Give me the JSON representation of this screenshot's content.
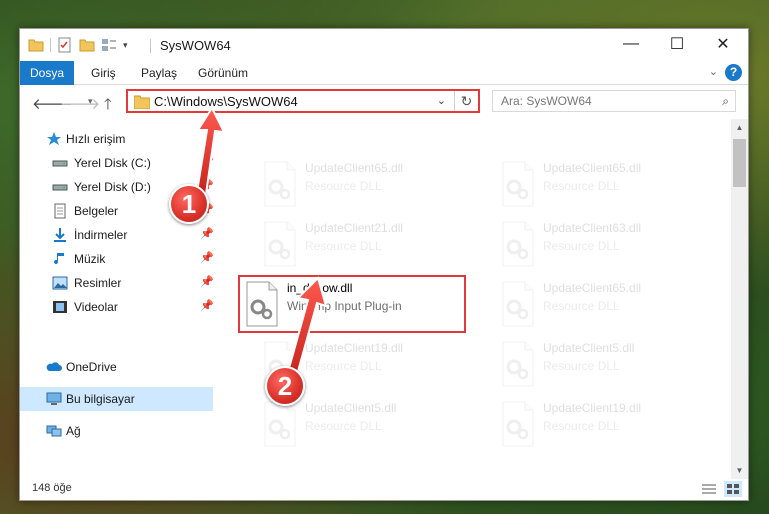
{
  "window": {
    "title": "SysWOW64",
    "controls": {
      "minimize": "—",
      "maximize": "☐",
      "close": "✕"
    }
  },
  "ribbon": {
    "tabs": [
      "Dosya",
      "Giriş",
      "Paylaş",
      "Görünüm"
    ],
    "help": "?"
  },
  "navigation": {
    "address": "C:\\Windows\\SysWOW64",
    "search_placeholder": "Ara: SysWOW64"
  },
  "sidebar": {
    "quick_access": "Hızlı erişim",
    "items": [
      {
        "label": "Yerel Disk (C:)",
        "icon": "drive-icon",
        "pinned": true
      },
      {
        "label": "Yerel Disk (D:)",
        "icon": "drive-icon",
        "pinned": true
      },
      {
        "label": "Belgeler",
        "icon": "documents-icon",
        "pinned": true
      },
      {
        "label": "İndirmeler",
        "icon": "downloads-icon",
        "pinned": true
      },
      {
        "label": "Müzik",
        "icon": "music-icon",
        "pinned": true
      },
      {
        "label": "Resimler",
        "icon": "pictures-icon",
        "pinned": true
      },
      {
        "label": "Videolar",
        "icon": "videos-icon",
        "pinned": true
      }
    ],
    "onedrive": "OneDrive",
    "this_pc": "Bu bilgisayar",
    "network": "Ağ"
  },
  "files": [
    {
      "name": "UpdateClient65.dll",
      "desc": "Resource DLL",
      "faded": true
    },
    {
      "name": "UpdateClient65.dll",
      "desc": "Resource DLL",
      "faded": true
    },
    {
      "name": "UpdateClient21.dll",
      "desc": "Resource DLL",
      "faded": true
    },
    {
      "name": "UpdateClient63.dll",
      "desc": "Resource DLL",
      "faded": true
    },
    {
      "name": "in_dshow.dll",
      "desc": "Winamp Input Plug-in",
      "faded": false,
      "highlighted": true
    },
    {
      "name": "UpdateClient65.dll",
      "desc": "Resource DLL",
      "faded": true
    },
    {
      "name": "UpdateClient19.dll",
      "desc": "Resource DLL",
      "faded": true
    },
    {
      "name": "UpdateClient5.dll",
      "desc": "Resource DLL",
      "faded": true
    },
    {
      "name": "UpdateClient5.dll",
      "desc": "Resource DLL",
      "faded": true
    },
    {
      "name": "UpdateClient19.dll",
      "desc": "Resource DLL",
      "faded": true
    }
  ],
  "status": {
    "count": "148 öğe"
  },
  "annotations": {
    "step1": "1",
    "step2": "2"
  },
  "colors": {
    "accent": "#1979ca",
    "highlight": "#e2393b",
    "selected": "#cde8ff"
  }
}
